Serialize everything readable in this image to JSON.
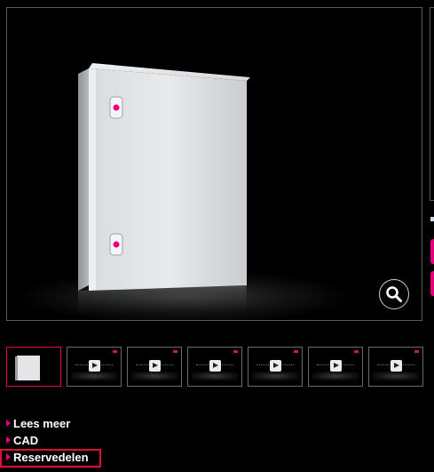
{
  "viewer": {
    "zoom_icon": "magnifier-icon",
    "product_image": "enclosure-cabinet"
  },
  "thumbnails": [
    {
      "type": "image",
      "active": true
    },
    {
      "type": "video",
      "active": false
    },
    {
      "type": "video",
      "active": false
    },
    {
      "type": "video",
      "active": false
    },
    {
      "type": "video",
      "active": false
    },
    {
      "type": "video",
      "active": false
    },
    {
      "type": "video",
      "active": false
    }
  ],
  "links": {
    "read_more": "Lees meer",
    "cad": "CAD",
    "spare_parts": "Reservedelen"
  },
  "colors": {
    "accent": "#e6007e",
    "highlight": "#e30d3c",
    "background": "#000000"
  }
}
